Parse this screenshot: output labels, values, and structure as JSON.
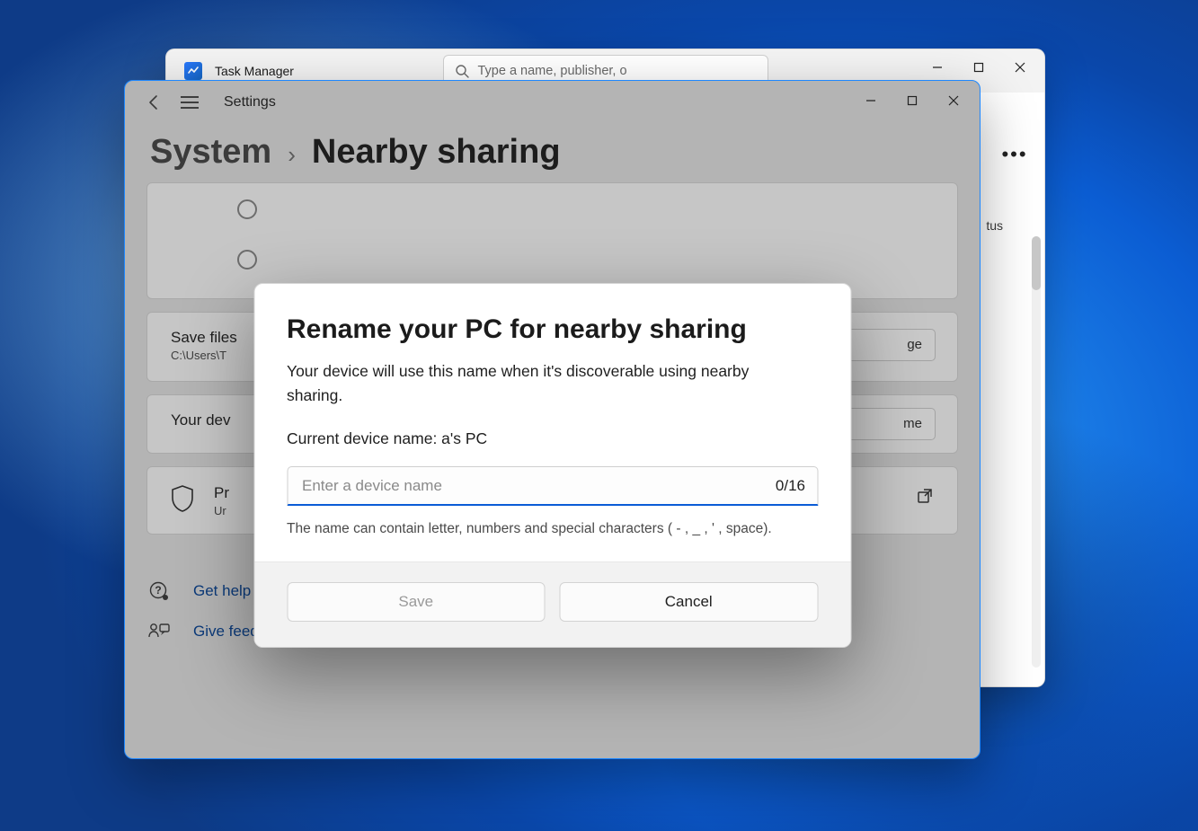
{
  "taskmgr": {
    "title": "Task Manager",
    "search_placeholder": "Type a name, publisher, o",
    "more_label": "•••",
    "status_col": "tus"
  },
  "settings": {
    "app_name": "Settings",
    "breadcrumb": {
      "root": "System",
      "page": "Nearby sharing"
    },
    "card_savefiles": {
      "title_visible": "Save files",
      "path_visible": "C:\\Users\\T",
      "button_visible": "ge"
    },
    "card_device": {
      "title_visible": "Your dev",
      "button_visible": "me"
    },
    "card_privacy": {
      "title_visible": "Pr",
      "subtitle_visible": "Ur"
    },
    "help": {
      "get_help": "Get help",
      "give_feedback": "Give feedback"
    }
  },
  "dialog": {
    "title": "Rename your PC for nearby sharing",
    "description": "Your device will use this name when it's discoverable using nearby sharing.",
    "current_label": "Current device name: a's PC",
    "input_placeholder": "Enter a device name",
    "input_value": "",
    "char_count": "0/16",
    "hint": "The name can contain letter, numbers and special characters ( - , _ , ' , space).",
    "save": "Save",
    "cancel": "Cancel"
  }
}
